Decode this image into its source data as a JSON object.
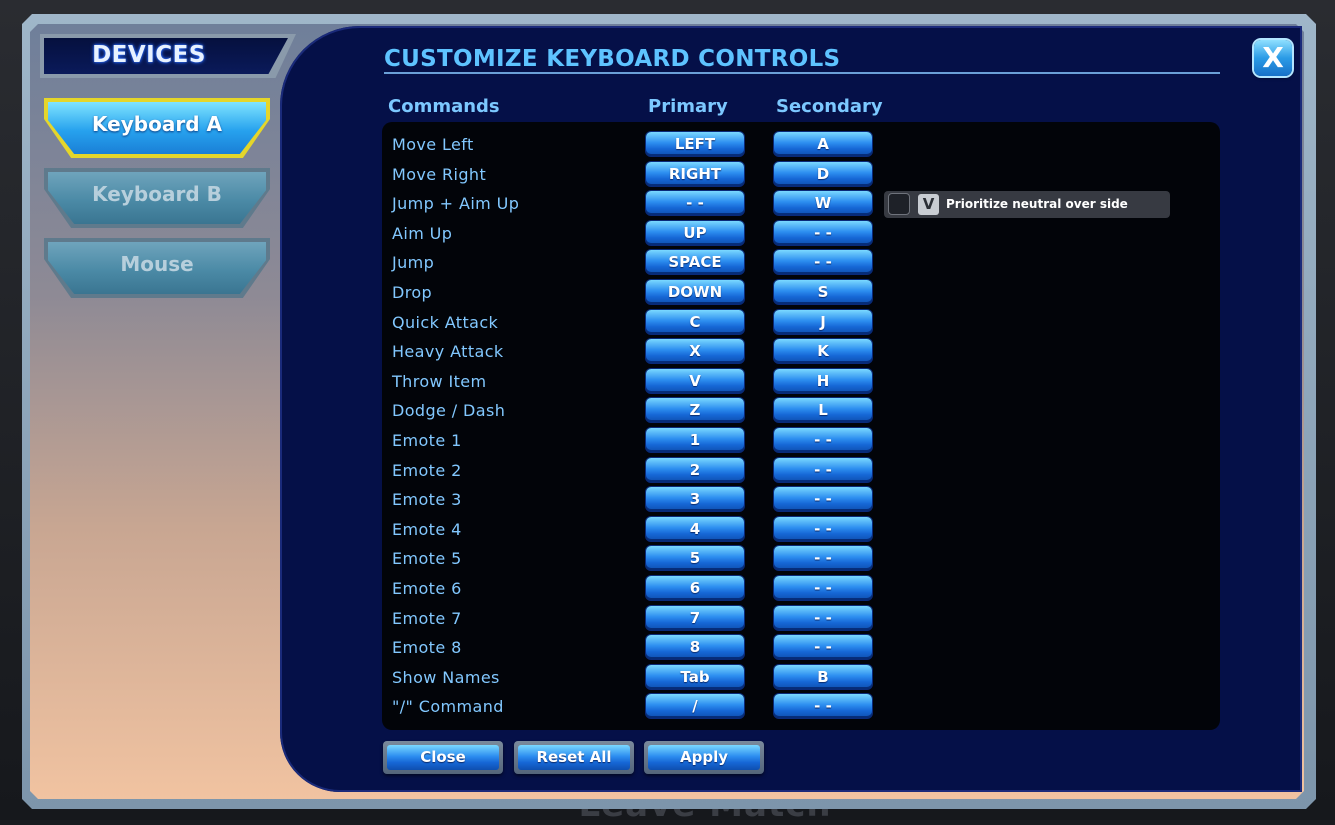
{
  "background": {
    "behind_text": "Leave Match"
  },
  "sidebar": {
    "title": "DEVICES",
    "devices": [
      {
        "label": "Keyboard A",
        "selected": true
      },
      {
        "label": "Keyboard B",
        "selected": false
      },
      {
        "label": "Mouse",
        "selected": false
      }
    ]
  },
  "main": {
    "title": "CUSTOMIZE KEYBOARD CONTROLS",
    "close_icon": "X",
    "columns": {
      "commands": "Commands",
      "primary": "Primary",
      "secondary": "Secondary"
    },
    "bindings": [
      {
        "command": "Move Left",
        "primary": "LEFT",
        "secondary": "A"
      },
      {
        "command": "Move Right",
        "primary": "RIGHT",
        "secondary": "D"
      },
      {
        "command": "Jump + Aim Up",
        "primary": "- -",
        "secondary": "W"
      },
      {
        "command": "Aim Up",
        "primary": "UP",
        "secondary": "- -"
      },
      {
        "command": "Jump",
        "primary": "SPACE",
        "secondary": "- -"
      },
      {
        "command": "Drop",
        "primary": "DOWN",
        "secondary": "S"
      },
      {
        "command": "Quick Attack",
        "primary": "C",
        "secondary": "J"
      },
      {
        "command": "Heavy Attack",
        "primary": "X",
        "secondary": "K"
      },
      {
        "command": "Throw Item",
        "primary": "V",
        "secondary": "H"
      },
      {
        "command": "Dodge / Dash",
        "primary": "Z",
        "secondary": "L"
      },
      {
        "command": "Emote 1",
        "primary": "1",
        "secondary": "- -"
      },
      {
        "command": "Emote 2",
        "primary": "2",
        "secondary": "- -"
      },
      {
        "command": "Emote 3",
        "primary": "3",
        "secondary": "- -"
      },
      {
        "command": "Emote 4",
        "primary": "4",
        "secondary": "- -"
      },
      {
        "command": "Emote 5",
        "primary": "5",
        "secondary": "- -"
      },
      {
        "command": "Emote 6",
        "primary": "6",
        "secondary": "- -"
      },
      {
        "command": "Emote 7",
        "primary": "7",
        "secondary": "- -"
      },
      {
        "command": "Emote 8",
        "primary": "8",
        "secondary": "- -"
      },
      {
        "command": "Show Names",
        "primary": "Tab",
        "secondary": "B"
      },
      {
        "command": "\"/\" Command",
        "primary": "/",
        "secondary": "- -"
      }
    ],
    "option": {
      "checked": false,
      "key_hint": "V",
      "label": "Prioritize neutral over side"
    },
    "buttons": {
      "close": "Close",
      "reset": "Reset All",
      "apply": "Apply"
    }
  },
  "colors": {
    "panel_navy": "#051048",
    "accent_blue": "#5ec3ff",
    "selected_outline": "#e5d62a"
  }
}
